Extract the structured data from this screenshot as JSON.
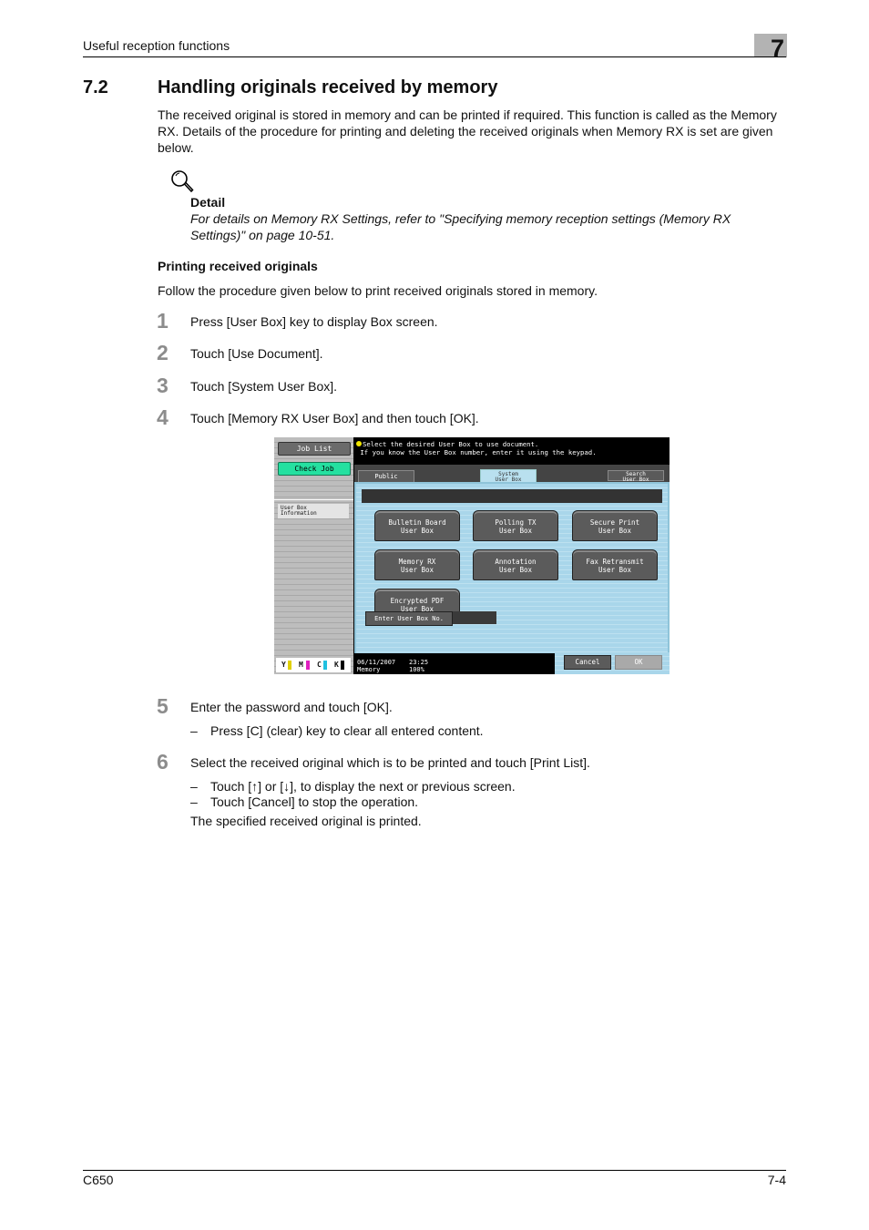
{
  "header": {
    "section_title": "Useful reception functions",
    "chapter_number": "7"
  },
  "section": {
    "number": "7.2",
    "title": "Handling originals received by memory"
  },
  "intro_paragraph": "The received original is stored in memory and can be printed if required. This function is called as the Memory RX. Details of the procedure for printing and deleting the received originals when Memory RX is set are given below.",
  "detail": {
    "icon": "magnifier-icon",
    "label": "Detail",
    "text": "For details on Memory RX Settings, refer to \"Specifying memory reception settings (Memory RX Settings)\" on page 10-51."
  },
  "subheading": "Printing received originals",
  "subheading_intro": "Follow the procedure given below to print received originals stored in memory.",
  "steps": [
    {
      "num": "1",
      "text": "Press [User Box] key to display Box screen."
    },
    {
      "num": "2",
      "text": "Touch [Use Document]."
    },
    {
      "num": "3",
      "text": "Touch [System User Box]."
    },
    {
      "num": "4",
      "text": "Touch [Memory RX User Box] and then touch [OK]."
    },
    {
      "num": "5",
      "text": "Enter the password and touch [OK].",
      "subs": [
        "Press [C] (clear) key to clear all entered content."
      ]
    },
    {
      "num": "6",
      "text": "Select the received original which is to be printed and touch [Print List].",
      "subs": [
        "Touch [↑] or [↓], to display the next or previous screen.",
        "Touch [Cancel] to stop the operation."
      ],
      "result": "The specified received original is printed."
    }
  ],
  "panel": {
    "left": {
      "job_list": "Job List",
      "check_job": "Check Job",
      "user_box_info": "User Box\nInformation"
    },
    "message": "Select the desired User Box to use document.\n If you know the User Box number, enter it using the keypad.",
    "tabs": {
      "public": "Public",
      "system": "System\nUser Box",
      "search": "Search\nUser Box"
    },
    "boxes": [
      "Bulletin Board\nUser Box",
      "Polling TX\nUser Box",
      "Secure Print\nUser Box",
      "Memory RX\nUser Box",
      "Annotation\nUser Box",
      "Fax Retransmit\nUser Box",
      "Encrypted PDF\nUser Box"
    ],
    "enter_box_no": "Enter User Box No.",
    "status": {
      "date": "06/11/2007",
      "time": "23:25",
      "memory_label": "Memory",
      "memory_value": "100%"
    },
    "toner": [
      {
        "label": "Y",
        "color": "#e0d000"
      },
      {
        "label": "M",
        "color": "#e020c0"
      },
      {
        "label": "C",
        "color": "#20c0e0"
      },
      {
        "label": "K",
        "color": "#000000"
      }
    ],
    "cancel": "Cancel",
    "ok": "OK"
  },
  "footer": {
    "model": "C650",
    "page": "7-4"
  }
}
